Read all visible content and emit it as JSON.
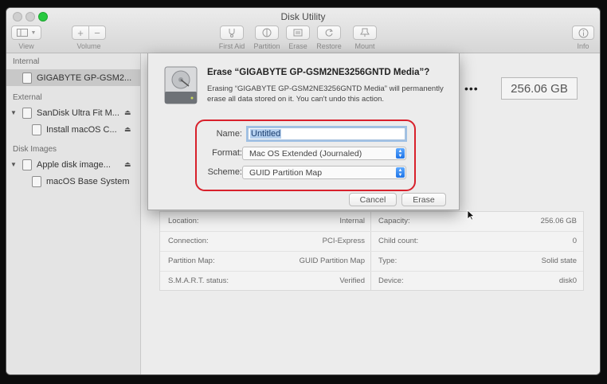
{
  "window": {
    "title": "Disk Utility"
  },
  "toolbar": {
    "view_label": "View",
    "volume_label": "Volume",
    "volume_add": "+",
    "volume_remove": "−",
    "first_aid_label": "First Aid",
    "partition_label": "Partition",
    "erase_label": "Erase",
    "restore_label": "Restore",
    "mount_label": "Mount",
    "info_label": "Info"
  },
  "sidebar": {
    "sections": [
      "Internal",
      "External",
      "Disk Images"
    ],
    "items": [
      {
        "label": "GIGABYTE GP-GSM2...",
        "section": "Internal",
        "selected": true
      },
      {
        "label": "SanDisk Ultra Fit M...",
        "section": "External"
      },
      {
        "label": "Install macOS C...",
        "section": "External"
      },
      {
        "label": "Apple disk image...",
        "section": "Disk Images"
      },
      {
        "label": "macOS Base System",
        "section": "Disk Images"
      }
    ],
    "disclosure_glyph": "▼",
    "eject_glyph": "⏏"
  },
  "main": {
    "size": "256.06 GB",
    "ellipsis": "•••",
    "info": {
      "left": [
        {
          "label": "Location:",
          "value": "Internal"
        },
        {
          "label": "Connection:",
          "value": "PCI-Express"
        },
        {
          "label": "Partition Map:",
          "value": "GUID Partition Map"
        },
        {
          "label": "S.M.A.R.T. status:",
          "value": "Verified"
        }
      ],
      "right": [
        {
          "label": "Capacity:",
          "value": "256.06 GB"
        },
        {
          "label": "Child count:",
          "value": "0"
        },
        {
          "label": "Type:",
          "value": "Solid state"
        },
        {
          "label": "Device:",
          "value": "disk0"
        }
      ]
    }
  },
  "sheet": {
    "title": "Erase “GIGABYTE GP-GSM2NE3256GNTD Media”?",
    "description": "Erasing “GIGABYTE GP-GSM2NE3256GNTD Media” will permanently erase all data stored on it. You can't undo this action.",
    "name_label": "Name:",
    "name_value": "Untitled",
    "format_label": "Format:",
    "format_value": "Mac OS Extended (Journaled)",
    "scheme_label": "Scheme:",
    "scheme_value": "GUID Partition Map",
    "cancel_label": "Cancel",
    "erase_label": "Erase"
  },
  "colors": {
    "highlight": "#d8202b",
    "accent": "#1f74e6"
  }
}
